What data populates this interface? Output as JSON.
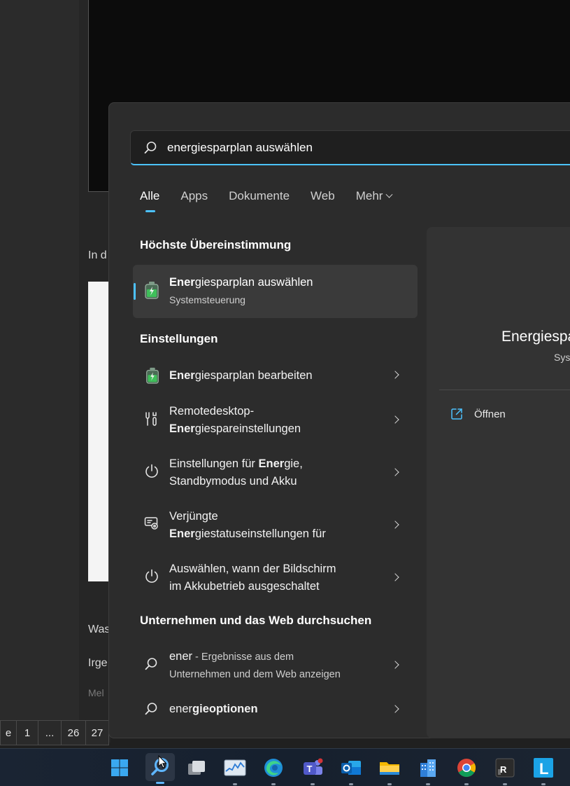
{
  "background": {
    "text_lines": [
      "In d",
      "Was",
      "Irge",
      "Mel"
    ],
    "pager": [
      "e",
      "1",
      "...",
      "26",
      "27"
    ]
  },
  "search": {
    "query": "energiesparplan auswählen",
    "search_icon": "search-icon"
  },
  "tabs": [
    {
      "label": "Alle",
      "active": true
    },
    {
      "label": "Apps"
    },
    {
      "label": "Dokumente"
    },
    {
      "label": "Web"
    },
    {
      "label": "Mehr",
      "has_dropdown": true
    }
  ],
  "best_match": {
    "heading": "Höchste Übereinstimmung",
    "title_bold": "Ener",
    "title_rest": "giesparplan auswählen",
    "subtitle": "Systemsteuerung",
    "icon": "battery-icon"
  },
  "settings": {
    "heading": "Einstellungen",
    "items": [
      {
        "icon": "battery-icon",
        "line1_bold": "Ener",
        "line1_rest": "giesparplan bearbeiten"
      },
      {
        "icon": "remote-desktop-icon",
        "line1": "Remotedesktop-",
        "line2_bold": "Ener",
        "line2_rest": "giespareinstellungen"
      },
      {
        "icon": "power-icon",
        "line1_pre": "Einstellungen für ",
        "line1_bold": "Ener",
        "line1_rest": "gie,",
        "line2": "Standbymodus und Akku"
      },
      {
        "icon": "display-settings-icon",
        "line1": "Verjüngte",
        "line2_bold": "Ener",
        "line2_rest": "giestatuseinstellungen für"
      },
      {
        "icon": "power-icon",
        "line1": "Auswählen, wann der Bildschirm",
        "line2": "im Akkubetrieb ausgeschaltet"
      }
    ]
  },
  "web": {
    "heading": "Unternehmen und das Web durchsuchen",
    "items": [
      {
        "icon": "search-icon",
        "bold": "ener",
        "rest": " - Ergebnisse aus dem",
        "line2": "Unternehmen und dem Web anzeigen"
      },
      {
        "icon": "search-icon",
        "pre": "ener",
        "bold": "gieoptionen"
      }
    ]
  },
  "preview": {
    "title": "Energiespa",
    "subtitle": "Sys",
    "open_label": "Öffnen",
    "open_icon": "open-external-icon"
  },
  "taskbar": {
    "icons": [
      "start-icon",
      "search-icon",
      "task-view-icon",
      "resource-monitor-icon",
      "edge-icon",
      "teams-icon",
      "outlook-icon",
      "file-explorer-icon",
      "buildings-app-icon",
      "chrome-icon",
      "mr-app-icon",
      "l-app-icon"
    ]
  },
  "colors": {
    "accent": "#4cc2ff",
    "flyout_bg": "#2c2c2c",
    "selected_row": "#3a3a3a"
  }
}
